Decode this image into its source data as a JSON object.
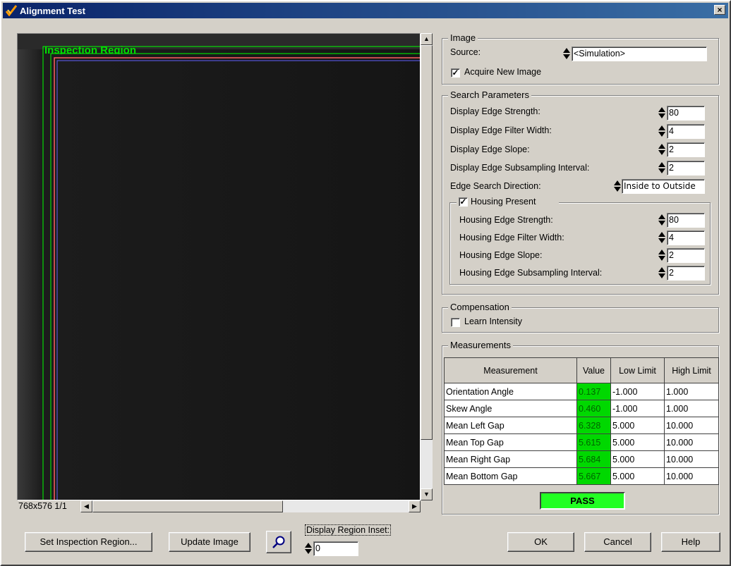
{
  "window": {
    "title": "Alignment Test",
    "close_label": "×"
  },
  "viewer": {
    "overlay_label": "Inspection Region",
    "status": "768x576 1/1"
  },
  "image_group": {
    "title": "Image",
    "source_label": "Source:",
    "source_value": "<Simulation>",
    "acquire_label": "Acquire New Image",
    "acquire_checked": true
  },
  "search_group": {
    "title": "Search Parameters",
    "params": [
      {
        "label": "Display Edge Strength:",
        "value": "80"
      },
      {
        "label": "Display Edge Filter Width:",
        "value": "4"
      },
      {
        "label": "Display Edge Slope:",
        "value": "2"
      },
      {
        "label": "Display Edge Subsampling Interval:",
        "value": "2"
      }
    ],
    "direction_label": "Edge Search Direction:",
    "direction_value": "Inside to Outside",
    "housing": {
      "title": "Housing Present",
      "checked": true,
      "params": [
        {
          "label": "Housing Edge Strength:",
          "value": "80"
        },
        {
          "label": "Housing Edge Filter Width:",
          "value": "4"
        },
        {
          "label": "Housing Edge Slope:",
          "value": "2"
        },
        {
          "label": "Housing Edge Subsampling Interval:",
          "value": "2"
        }
      ]
    }
  },
  "compensation_group": {
    "title": "Compensation",
    "learn_label": "Learn Intensity",
    "learn_checked": false
  },
  "measurements_group": {
    "title": "Measurements",
    "headers": [
      "Measurement",
      "Value",
      "Low Limit",
      "High Limit"
    ],
    "rows": [
      {
        "name": "Orientation Angle",
        "value": "0.137",
        "low": "-1.000",
        "high": "1.000"
      },
      {
        "name": "Skew Angle",
        "value": "0.460",
        "low": "-1.000",
        "high": "1.000"
      },
      {
        "name": "Mean Left Gap",
        "value": "6.328",
        "low": "5.000",
        "high": "10.000"
      },
      {
        "name": "Mean Top Gap",
        "value": "5.615",
        "low": "5.000",
        "high": "10.000"
      },
      {
        "name": "Mean Right Gap",
        "value": "5.684",
        "low": "5.000",
        "high": "10.000"
      },
      {
        "name": "Mean Bottom Gap",
        "value": "5.667",
        "low": "5.000",
        "high": "10.000"
      }
    ],
    "result": "PASS",
    "result_color": "#22ff22",
    "value_color": "#00d800"
  },
  "bottom": {
    "set_region_label": "Set Inspection Region...",
    "update_image_label": "Update Image",
    "inset_label": "Display Region Inset:",
    "inset_value": "0",
    "ok_label": "OK",
    "cancel_label": "Cancel",
    "help_label": "Help"
  }
}
